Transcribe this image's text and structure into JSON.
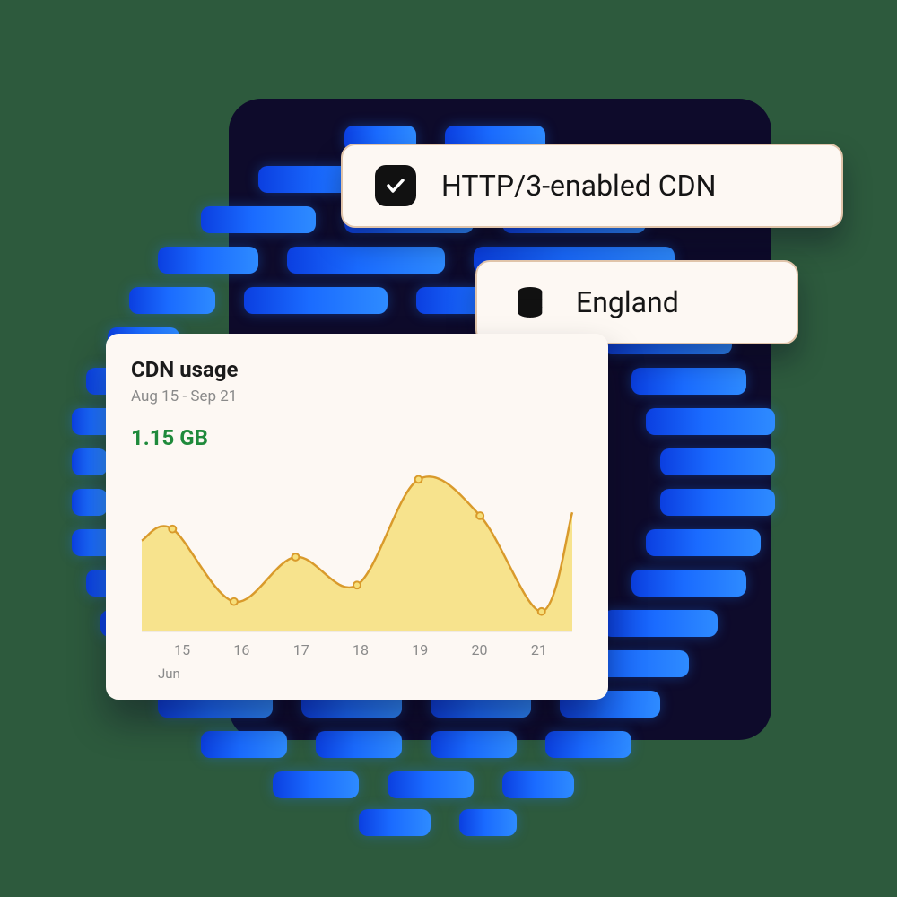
{
  "chips": {
    "http3": {
      "label": "HTTP/3-enabled CDN",
      "checked": true
    },
    "location": {
      "label": "England"
    }
  },
  "card": {
    "title": "CDN usage",
    "range": "Aug 15 - Sep 21",
    "metric": "1.15 GB",
    "month": "Jun"
  },
  "chart_data": {
    "type": "area",
    "title": "CDN usage",
    "xlabel": "Jun",
    "ylabel": "",
    "categories": [
      "15",
      "16",
      "17",
      "18",
      "19",
      "20",
      "21"
    ],
    "values": [
      62,
      18,
      45,
      28,
      92,
      70,
      12
    ],
    "ylim": [
      0,
      100
    ],
    "color_fill": "#f6df7a",
    "color_stroke": "#d99a2b"
  },
  "colors": {
    "accent_green": "#1f8a3b",
    "card_bg": "#fdf8f3",
    "panel_bg": "#0e0b2b",
    "page_bg": "#2d5a3d"
  }
}
